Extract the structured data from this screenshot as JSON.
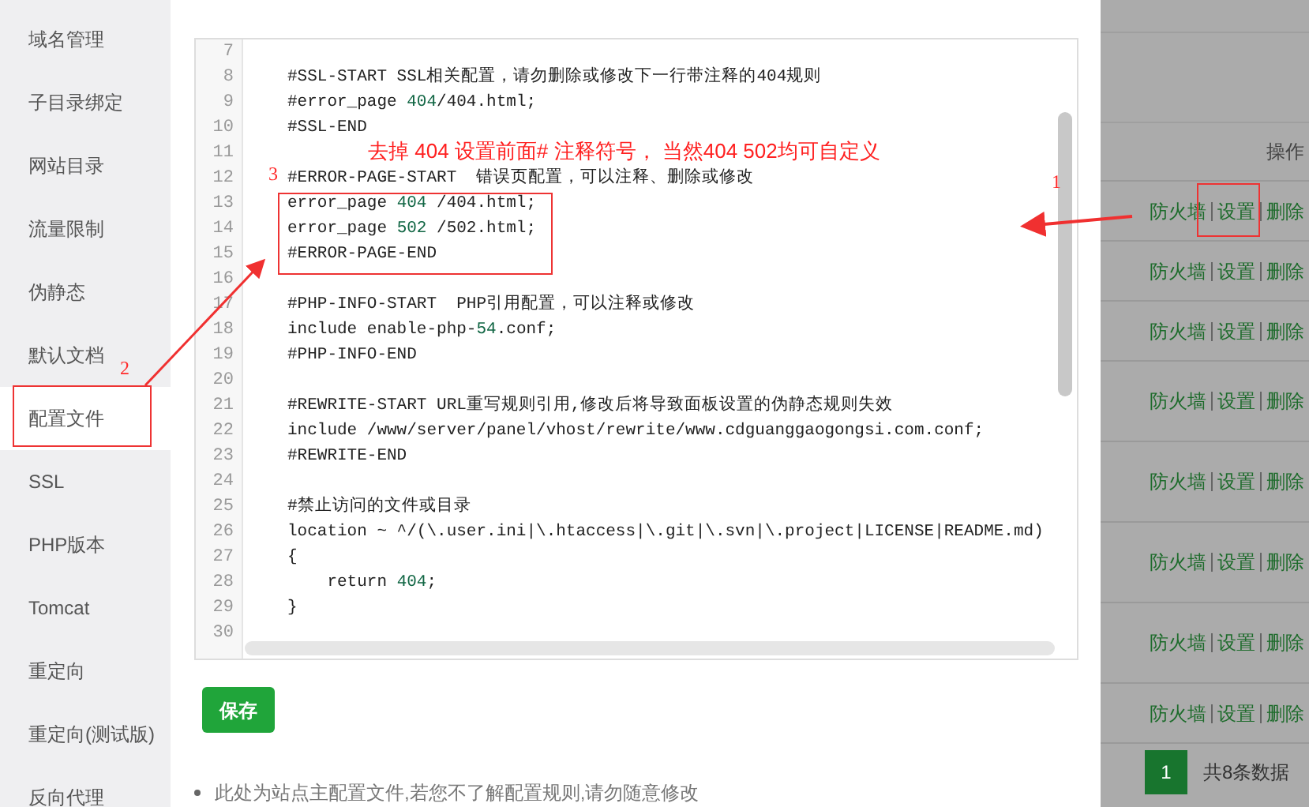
{
  "sidebar": {
    "items": [
      {
        "label": "域名管理",
        "selected": false
      },
      {
        "label": "子目录绑定",
        "selected": false
      },
      {
        "label": "网站目录",
        "selected": false
      },
      {
        "label": "流量限制",
        "selected": false
      },
      {
        "label": "伪静态",
        "selected": false
      },
      {
        "label": "默认文档",
        "selected": false
      },
      {
        "label": "配置文件",
        "selected": true
      },
      {
        "label": "SSL",
        "selected": false
      },
      {
        "label": "PHP版本",
        "selected": false
      },
      {
        "label": "Tomcat",
        "selected": false
      },
      {
        "label": "重定向",
        "selected": false
      },
      {
        "label": "重定向(测试版)",
        "selected": false
      },
      {
        "label": "反向代理",
        "selected": false
      }
    ]
  },
  "editor": {
    "lines": [
      {
        "number": "7"
      },
      {
        "number": "8",
        "parts": [
          {
            "text": "#SSL-START SSL相关配置，请勿删除或修改下一行带注释的404规则",
            "kind": "code"
          }
        ]
      },
      {
        "number": "9",
        "parts": [
          {
            "text": "#error_page ",
            "kind": "code"
          },
          {
            "text": "404",
            "kind": "number"
          },
          {
            "text": "/404.html;",
            "kind": "code"
          }
        ]
      },
      {
        "number": "10",
        "parts": [
          {
            "text": "#SSL-END",
            "kind": "code"
          }
        ]
      },
      {
        "number": "11",
        "parts": [
          {
            "text": "去掉 404 设置前面# 注释符号， 当然404 502均可自定义",
            "kind": "note"
          }
        ]
      },
      {
        "number": "12",
        "parts": [
          {
            "text": "#ERROR-PAGE-START  错误页配置，可以注释、删除或修改",
            "kind": "code"
          }
        ]
      },
      {
        "number": "13",
        "parts": [
          {
            "text": "error_page ",
            "kind": "code"
          },
          {
            "text": "404",
            "kind": "number"
          },
          {
            "text": " /404.html;",
            "kind": "code"
          }
        ]
      },
      {
        "number": "14",
        "parts": [
          {
            "text": "error_page ",
            "kind": "code"
          },
          {
            "text": "502",
            "kind": "number"
          },
          {
            "text": " /502.html;",
            "kind": "code"
          }
        ]
      },
      {
        "number": "15",
        "parts": [
          {
            "text": "#ERROR-PAGE-END",
            "kind": "code"
          }
        ]
      },
      {
        "number": "16"
      },
      {
        "number": "17",
        "parts": [
          {
            "text": "#PHP-INFO-START  PHP引用配置，可以注释或修改",
            "kind": "code"
          }
        ]
      },
      {
        "number": "18",
        "parts": [
          {
            "text": "include enable-php-",
            "kind": "code"
          },
          {
            "text": "54",
            "kind": "number"
          },
          {
            "text": ".conf;",
            "kind": "code"
          }
        ]
      },
      {
        "number": "19",
        "parts": [
          {
            "text": "#PHP-INFO-END",
            "kind": "code"
          }
        ]
      },
      {
        "number": "20"
      },
      {
        "number": "21",
        "parts": [
          {
            "text": "#REWRITE-START URL重写规则引用,修改后将导致面板设置的伪静态规则失效",
            "kind": "code"
          }
        ]
      },
      {
        "number": "22",
        "parts": [
          {
            "text": "include /www/server/panel/vhost/rewrite/www.cdguanggaogongsi.com.conf;",
            "kind": "code"
          }
        ]
      },
      {
        "number": "23",
        "parts": [
          {
            "text": "#REWRITE-END",
            "kind": "code"
          }
        ]
      },
      {
        "number": "24"
      },
      {
        "number": "25",
        "parts": [
          {
            "text": "#禁止访问的文件或目录",
            "kind": "code"
          }
        ]
      },
      {
        "number": "26",
        "parts": [
          {
            "text": "location ~ ^/(\\.user.ini|\\.htaccess|\\.git|\\.svn|\\.project|LICENSE|README.md)",
            "kind": "code"
          }
        ]
      },
      {
        "number": "27",
        "parts": [
          {
            "text": "{",
            "kind": "code"
          }
        ]
      },
      {
        "number": "28",
        "parts": [
          {
            "text": "    return ",
            "kind": "code"
          },
          {
            "text": "404",
            "kind": "number"
          },
          {
            "text": ";",
            "kind": "code"
          }
        ]
      },
      {
        "number": "29",
        "parts": [
          {
            "text": "}",
            "kind": "code"
          }
        ]
      },
      {
        "number": "30"
      }
    ]
  },
  "save_button": "保存",
  "note": "此处为站点主配置文件,若您不了解配置规则,请勿随意修改",
  "table": {
    "header": "操作",
    "rows": [
      {
        "actions": [
          "防火墙",
          "设置",
          "删除"
        ]
      },
      {
        "actions": [
          "防火墙",
          "设置",
          "删除"
        ]
      },
      {
        "actions": [
          "防火墙",
          "设置",
          "删除"
        ]
      },
      {
        "actions": [
          "防火墙",
          "设置",
          "删除"
        ]
      },
      {
        "actions": [
          "防火墙",
          "设置",
          "删除"
        ]
      },
      {
        "actions": [
          "防火墙",
          "设置",
          "删除"
        ]
      },
      {
        "actions": [
          "防火墙",
          "设置",
          "删除"
        ]
      },
      {
        "actions": [
          "防火墙",
          "设置",
          "删除"
        ]
      }
    ],
    "pagination": {
      "page": "1",
      "total": "共8条数据"
    }
  },
  "annotations": {
    "markers": [
      "1",
      "2",
      "3"
    ]
  }
}
